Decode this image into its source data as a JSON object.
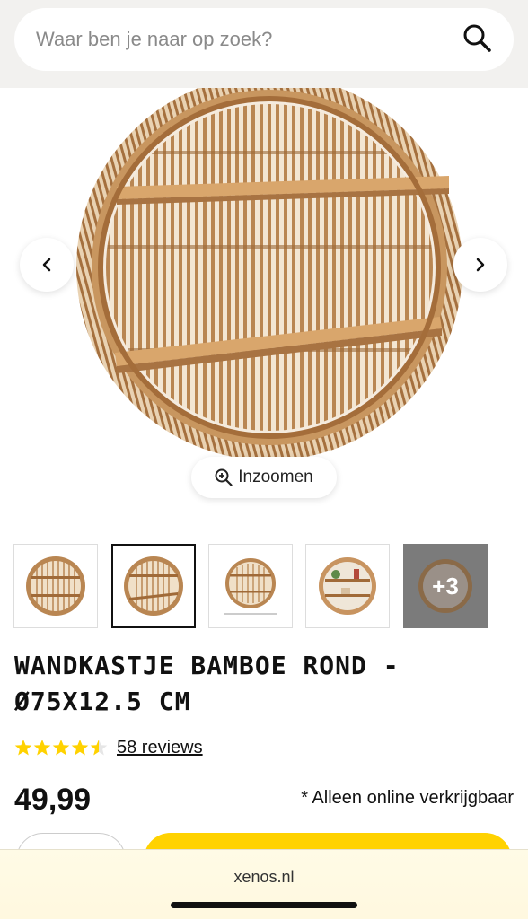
{
  "search": {
    "placeholder": "Waar ben je naar op zoek?",
    "icon": "search-icon"
  },
  "gallery": {
    "prev_icon": "chevron-left-icon",
    "next_icon": "chevron-right-icon",
    "zoom_label": "Inzoomen",
    "zoom_icon": "zoom-in-icon",
    "thumbnails": [
      {
        "alt": "product-front"
      },
      {
        "alt": "product-angle",
        "active": true
      },
      {
        "alt": "product-dimensions"
      },
      {
        "alt": "product-styled"
      },
      {
        "alt": "product-more"
      }
    ],
    "more_count": "+3"
  },
  "product": {
    "title_line1": "WANDKASTJE BAMBOE ROND -",
    "title_line2": "Ø75X12.5 CM",
    "rating": 4.5,
    "rating_max": 5,
    "reviews_label": "58 reviews",
    "price": "49,99",
    "availability_note": "* Alleen online verkrijgbaar"
  },
  "browser": {
    "url": "xenos.nl"
  },
  "colors": {
    "accent_yellow": "#ffd200",
    "star": "#ffd200",
    "wood": "#b07a45"
  }
}
